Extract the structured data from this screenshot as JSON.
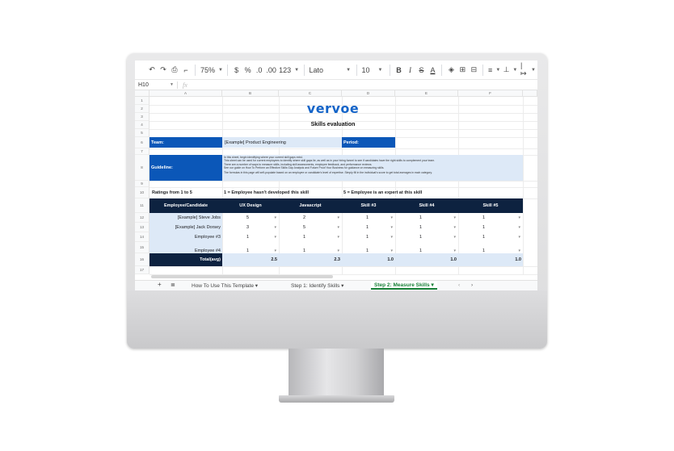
{
  "toolbar": {
    "undo_icon": "undo-icon",
    "redo_icon": "redo-icon",
    "zoom": "75%",
    "currency": "$",
    "percent": "%",
    "dec_minus": ".0",
    "dec_plus": ".00",
    "number_format": "123",
    "font": "Lato",
    "font_size": "10",
    "bold": "B",
    "italic": "I",
    "strike": "S",
    "text_color": "A"
  },
  "formula_bar": {
    "cell_ref": "H10",
    "fx": "fx"
  },
  "columns": [
    "A",
    "B",
    "C",
    "D",
    "E",
    "F"
  ],
  "rows": [
    "1",
    "2",
    "3",
    "4",
    "5",
    "6",
    "7",
    "8",
    "9",
    "10",
    "11",
    "12",
    "13",
    "14",
    "15",
    "16",
    "17"
  ],
  "sheet": {
    "logo": "vervoe",
    "title": "Skills evaluation",
    "team_label": "Team:",
    "team_value": "[Example] Product Engineering",
    "period_label": "Period:",
    "guideline_label": "Guideline:",
    "guideline_text": [
      "In this sheet, begin identifying where your current skill gaps exist.",
      "This sheet can be used for current employees to identify where skill gaps lie, as well as in your hiring funnel to see if candidates have the right skills to complement your team.",
      "There are a number of ways to measure skills, including skill assessments, employee feedback, and performance reviews.",
      "See our guide on How To Perform an Effective Skills Gap Analysis and Future Proof Your Business for guidance on measuring skills.",
      "",
      "The formulas in this page will self-populate based on an employee or candidate's level of expertise. Simply fill in the individual's score to get total averages in each category."
    ],
    "ratings_label": "Ratings from 1 to 5",
    "rating_low": "1 = Employee hasn't developed this skill",
    "rating_high": "5 = Employee is an expert at this skill",
    "headers": [
      "Employee/Candidate",
      "UX Design",
      "Javascript",
      "Skill #3",
      "Skill #4",
      "Skill #5"
    ],
    "employees": [
      {
        "name": "[Example] Steve Jobs",
        "scores": [
          "5",
          "2",
          "1",
          "1",
          "1"
        ]
      },
      {
        "name": "[Example] Jack Dorsey",
        "scores": [
          "3",
          "5",
          "1",
          "1",
          "1"
        ]
      },
      {
        "name": "Employee #3",
        "scores": [
          "1",
          "1",
          "1",
          "1",
          "1"
        ]
      },
      {
        "name": "Employee #4",
        "scores": [
          "1",
          "1",
          "1",
          "1",
          "1"
        ]
      }
    ],
    "total_label": "Total(avg)",
    "totals": [
      "2.5",
      "2.3",
      "1.0",
      "1.0",
      "1.0"
    ]
  },
  "tabs": {
    "add_icon": "plus-icon",
    "menu_icon": "sheet-list-icon",
    "items": [
      "How To Use This Template",
      "Step 1: Identify Skills",
      "Step 2: Measure Skills"
    ],
    "active_index": 2
  },
  "colors": {
    "brand_blue": "#0b57b8",
    "navy": "#0d2240",
    "pale_blue": "#dde9f7",
    "active_tab": "#188038"
  }
}
